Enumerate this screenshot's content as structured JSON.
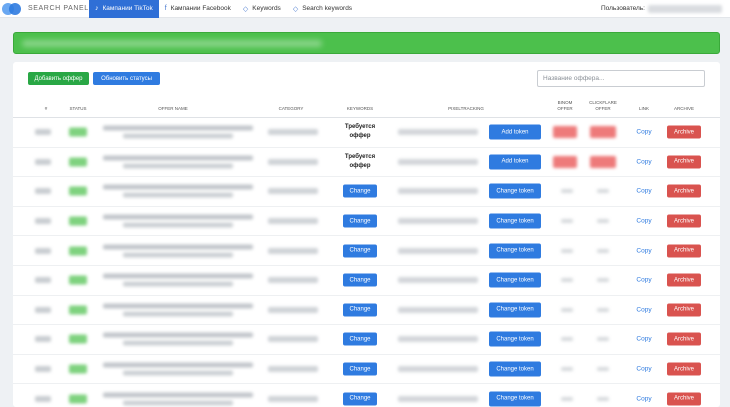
{
  "nav": {
    "logo_text": "SEARCH PANEL",
    "items": [
      {
        "label": "Кампании TikTok",
        "icon": "tiktok-icon",
        "active": true
      },
      {
        "label": "Кампании Facebook",
        "icon": "facebook-icon",
        "active": false
      },
      {
        "label": "Keywords",
        "icon": "tag-icon",
        "active": false
      },
      {
        "label": "Search keywords",
        "icon": "tag-icon",
        "active": false
      }
    ],
    "user_label": "Пользователь:"
  },
  "toolbar": {
    "add_offer_label": "Добавить оффер",
    "refresh_label": "Обновить статусы",
    "search_placeholder": "Название оффера..."
  },
  "table": {
    "headers": {
      "id": "#",
      "status": "STATUS",
      "offer_name": "OFFER NAME",
      "category": "CATEGORY",
      "keywords": "KEYWORDS",
      "pixel": "PIXELTRACKING",
      "binom": "BINOM OFFER",
      "clickflare": "CLICKFLARE OFFER",
      "link": "LINK",
      "archive": "ARCHIVE"
    },
    "rows": [
      {
        "keywords_text": "Требуется оффер",
        "token_label": "Add token",
        "copy_label": "Copy",
        "archive_label": "Archive"
      },
      {
        "keywords_text": "Требуется оффер",
        "token_label": "Add token",
        "copy_label": "Copy",
        "archive_label": "Archive"
      },
      {
        "change_label": "Change",
        "token_label": "Change token",
        "copy_label": "Copy",
        "archive_label": "Archive"
      },
      {
        "change_label": "Change",
        "token_label": "Change token",
        "copy_label": "Copy",
        "archive_label": "Archive"
      },
      {
        "change_label": "Change",
        "token_label": "Change token",
        "copy_label": "Copy",
        "archive_label": "Archive"
      },
      {
        "change_label": "Change",
        "token_label": "Change token",
        "copy_label": "Copy",
        "archive_label": "Archive"
      },
      {
        "change_label": "Change",
        "token_label": "Change token",
        "copy_label": "Copy",
        "archive_label": "Archive"
      },
      {
        "change_label": "Change",
        "token_label": "Change token",
        "copy_label": "Copy",
        "archive_label": "Archive"
      },
      {
        "change_label": "Change",
        "token_label": "Change token",
        "copy_label": "Copy",
        "archive_label": "Archive"
      },
      {
        "change_label": "Change",
        "token_label": "Change token",
        "copy_label": "Copy",
        "archive_label": "Archive"
      }
    ]
  },
  "colors": {
    "nav_active": "#2f6fd6",
    "banner": "#4cc04c",
    "primary_button": "#2f7be0",
    "success_button": "#29a745",
    "danger_button": "#d9534f"
  }
}
